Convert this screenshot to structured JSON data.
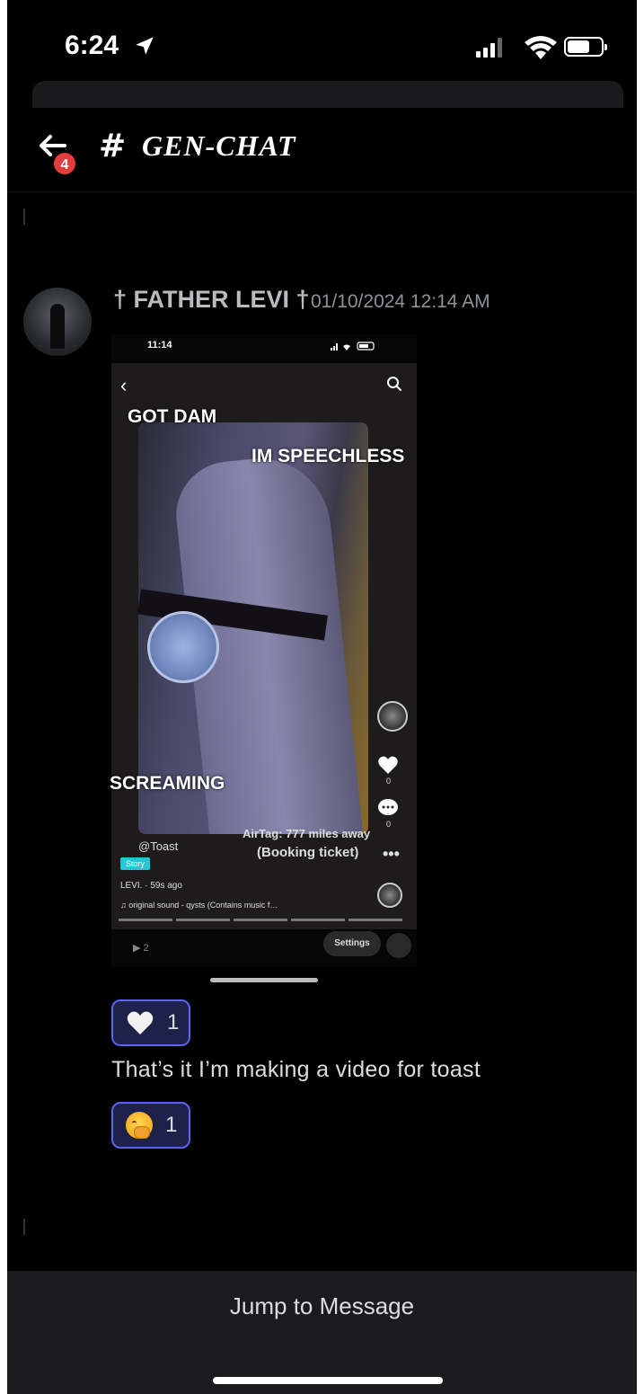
{
  "status_bar": {
    "time": "6:24"
  },
  "header": {
    "notification_count": "4",
    "hash": "#",
    "channel_name": "GEN-CHAT"
  },
  "message": {
    "author": "† FATHER LEVI †",
    "timestamp": "01/10/2024 12:14 AM",
    "text": "That’s it I’m making a video for toast",
    "reactions": [
      {
        "icon": "heart-icon",
        "count": "1"
      },
      {
        "icon": "face-with-hand-over-mouth-icon",
        "count": "1"
      }
    ]
  },
  "attachment": {
    "status_time": "11:14",
    "captions": {
      "top_left": "GOT DAM",
      "top_right": "IM SPEECHLESS",
      "bottom_left": "SCREAMING",
      "airtag": "AirTag: 777 miles away",
      "booking": "(Booking ticket)"
    },
    "rail_counts": {
      "likes": "0",
      "comments": "0"
    },
    "username": "@Toast",
    "story_badge": "Story",
    "poster_line": "LEVI. · 59s ago",
    "sound_line": "♫ original sound - qysts (Contains music f…",
    "views": "▶ 2",
    "settings_label": "Settings"
  },
  "bottom_bar": {
    "jump_label": "Jump to Message"
  },
  "colors": {
    "background": "#000000",
    "reaction_border": "#5865f2",
    "reaction_bg": "#1e2149",
    "badge_red": "#e23c3c",
    "bottom_bar": "#1b1b1d"
  }
}
